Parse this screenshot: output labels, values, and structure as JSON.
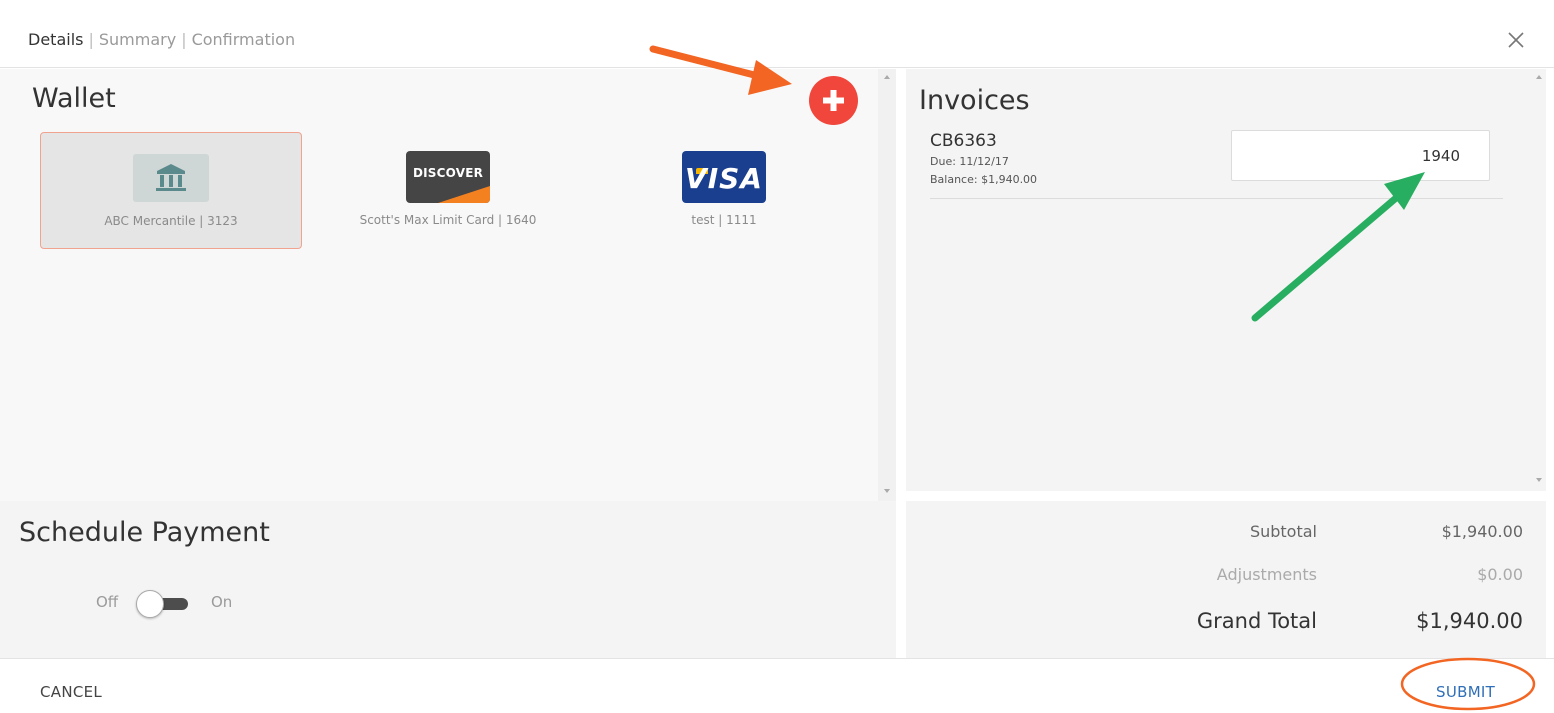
{
  "steps": [
    "Details",
    "Summary",
    "Confirmation"
  ],
  "steps_separator": "|",
  "wallet": {
    "title": "Wallet",
    "cards": [
      {
        "label": "ABC Mercantile | 3123",
        "type": "bank",
        "selected": true
      },
      {
        "label": "Scott's Max Limit Card | 1640",
        "type": "discover",
        "brand_text": "DISCOVER"
      },
      {
        "label": "test | 1111",
        "type": "visa",
        "brand_text": "VISA"
      }
    ]
  },
  "invoices": {
    "title": "Invoices",
    "items": [
      {
        "id": "CB6363",
        "due": "Due: 11/12/17",
        "balance": "Balance: $1,940.00",
        "amount": "1940"
      }
    ]
  },
  "schedule": {
    "title": "Schedule Payment",
    "toggle_off_label": "Off",
    "toggle_on_label": "On",
    "enabled": false
  },
  "totals": {
    "subtotal_label": "Subtotal",
    "subtotal_value": "$1,940.00",
    "adjustments_label": "Adjustments",
    "adjustments_value": "$0.00",
    "grand_total_label": "Grand Total",
    "grand_total_value": "$1,940.00"
  },
  "footer": {
    "cancel_label": "CANCEL",
    "submit_label": "SUBMIT"
  },
  "colors": {
    "add_button": "#f0463c",
    "submit_text": "#2f6fb7",
    "annotation_orange": "#f26522",
    "annotation_green": "#27ae60",
    "selected_border": "#f0a38f"
  }
}
